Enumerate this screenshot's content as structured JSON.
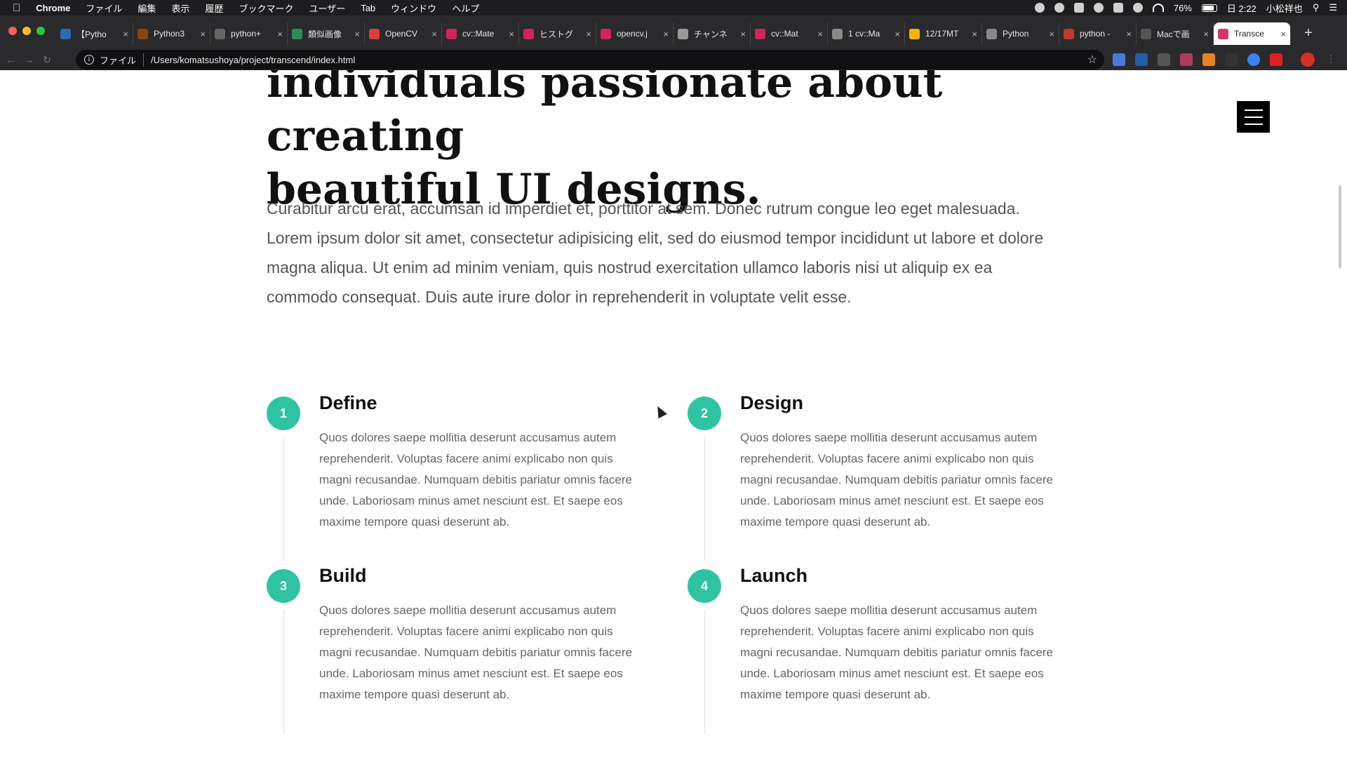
{
  "menubar": {
    "app": "Chrome",
    "items": [
      "ファイル",
      "編集",
      "表示",
      "履歴",
      "ブックマーク",
      "ユーザー",
      "Tab",
      "ウィンドウ",
      "ヘルプ"
    ],
    "battery": "76%",
    "clock": "日 2:22",
    "user": "小松祥也"
  },
  "tabs": [
    {
      "title": "【Pytho",
      "color": "#2b6cb0"
    },
    {
      "title": "Python3",
      "color": "#8b4513"
    },
    {
      "title": "python+",
      "color": "#666666"
    },
    {
      "title": "類似画像",
      "color": "#2e8b57"
    },
    {
      "title": "OpenCV",
      "color": "#e23b3b"
    },
    {
      "title": "cv::Mate",
      "color": "#d0245a"
    },
    {
      "title": "ヒストグ",
      "color": "#d0245a"
    },
    {
      "title": "opencv.j",
      "color": "#d0245a"
    },
    {
      "title": "チャンネ",
      "color": "#999999"
    },
    {
      "title": "cv::Mat",
      "color": "#d0245a"
    },
    {
      "title": "1 cv::Ma",
      "color": "#888888"
    },
    {
      "title": "12/17MT",
      "color": "#f4b400"
    },
    {
      "title": "Python",
      "color": "#888888"
    },
    {
      "title": "python -",
      "color": "#c0392b"
    },
    {
      "title": "Macで画",
      "color": "#555555"
    },
    {
      "title": "Transce",
      "color": "#d6336c",
      "active": true
    }
  ],
  "omnibox": {
    "scheme": "ファイル",
    "url": "/Users/komatsushoya/project/transcend/index.html"
  },
  "page": {
    "hero_line1": "individuals passionate about creating",
    "hero_line2": "beautiful UI designs.",
    "intro": "Curabitur arcu erat, accumsan id imperdiet et, porttitor at sem. Donec rutrum congue leo eget malesuada. Lorem ipsum dolor sit amet, consectetur adipisicing elit, sed do eiusmod tempor incididunt ut labore et dolore magna aliqua. Ut enim ad minim veniam, quis nostrud exercitation ullamco laboris nisi ut aliquip ex ea commodo consequat. Duis aute irure dolor in reprehenderit in voluptate velit esse.",
    "steps": [
      {
        "number": "1",
        "title": "Define",
        "body": "Quos dolores saepe mollitia deserunt accusamus autem reprehenderit. Voluptas facere animi explicabo non quis magni recusandae. Numquam debitis pariatur omnis facere unde. Laboriosam minus amet nesciunt est. Et saepe eos maxime tempore quasi deserunt ab."
      },
      {
        "number": "2",
        "title": "Design",
        "body": "Quos dolores saepe mollitia deserunt accusamus autem reprehenderit. Voluptas facere animi explicabo non quis magni recusandae. Numquam debitis pariatur omnis facere unde. Laboriosam minus amet nesciunt est. Et saepe eos maxime tempore quasi deserunt ab."
      },
      {
        "number": "3",
        "title": "Build",
        "body": "Quos dolores saepe mollitia deserunt accusamus autem reprehenderit. Voluptas facere animi explicabo non quis magni recusandae. Numquam debitis pariatur omnis facere unde. Laboriosam minus amet nesciunt est. Et saepe eos maxime tempore quasi deserunt ab."
      },
      {
        "number": "4",
        "title": "Launch",
        "body": "Quos dolores saepe mollitia deserunt accusamus autem reprehenderit. Voluptas facere animi explicabo non quis magni recusandae. Numquam debitis pariatur omnis facere unde. Laboriosam minus amet nesciunt est. Et saepe eos maxime tempore quasi deserunt ab."
      }
    ]
  },
  "colors": {
    "accent": "#2ec4a3",
    "hamburger": "#000000"
  }
}
